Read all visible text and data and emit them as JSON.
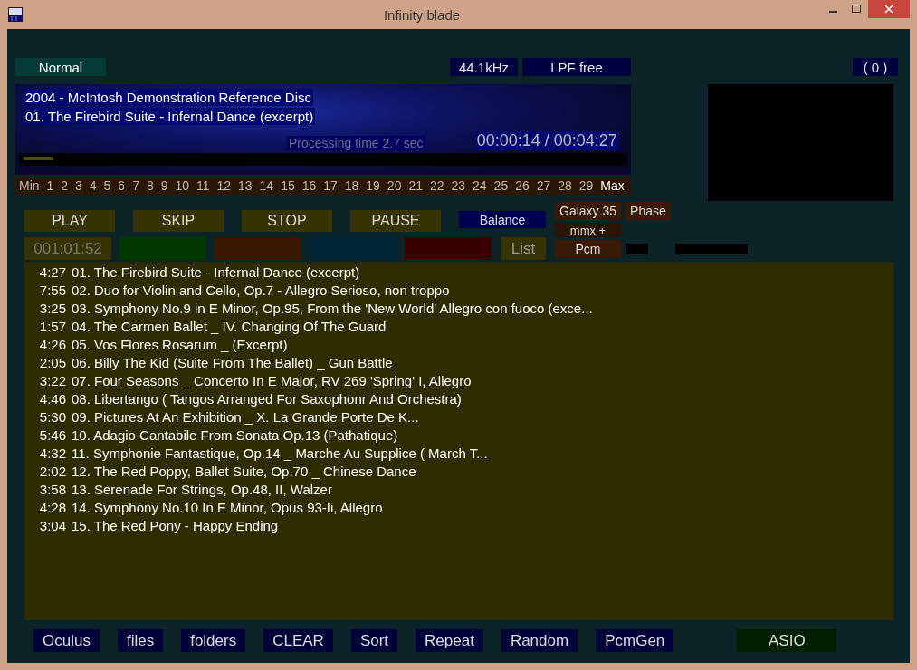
{
  "window": {
    "title": "Infinity blade"
  },
  "top_bar": {
    "mode": "Normal",
    "sample_rate": "44.1kHz",
    "filter": "LPF free",
    "counter": "( 0 )"
  },
  "now_playing": {
    "album": "2004 - McIntosh Demonstration Reference Disc",
    "track": "01. The Firebird Suite - Infernal Dance (excerpt)",
    "processing": "Processing time  2.7 sec",
    "time": "00:00:14 / 00:04:27",
    "level": 0.05
  },
  "scale": [
    {
      "label": "Min",
      "selected": false
    },
    {
      "label": "1",
      "selected": false
    },
    {
      "label": "2",
      "selected": false
    },
    {
      "label": "3",
      "selected": false
    },
    {
      "label": "4",
      "selected": false
    },
    {
      "label": "5",
      "selected": false
    },
    {
      "label": "6",
      "selected": false
    },
    {
      "label": "7",
      "selected": false
    },
    {
      "label": "8",
      "selected": false
    },
    {
      "label": "9",
      "selected": false
    },
    {
      "label": "10",
      "selected": false
    },
    {
      "label": "11",
      "selected": false
    },
    {
      "label": "12",
      "selected": false
    },
    {
      "label": "13",
      "selected": false
    },
    {
      "label": "14",
      "selected": false
    },
    {
      "label": "15",
      "selected": false
    },
    {
      "label": "16",
      "selected": false
    },
    {
      "label": "17",
      "selected": false
    },
    {
      "label": "18",
      "selected": false
    },
    {
      "label": "19",
      "selected": false
    },
    {
      "label": "20",
      "selected": false
    },
    {
      "label": "21",
      "selected": false
    },
    {
      "label": "22",
      "selected": false
    },
    {
      "label": "23",
      "selected": false
    },
    {
      "label": "24",
      "selected": false
    },
    {
      "label": "25",
      "selected": false
    },
    {
      "label": "26",
      "selected": false
    },
    {
      "label": "27",
      "selected": false
    },
    {
      "label": "28",
      "selected": false
    },
    {
      "label": "29",
      "selected": false
    },
    {
      "label": "Max",
      "selected": true
    }
  ],
  "transport": [
    "PLAY",
    "SKIP",
    "STOP",
    "PAUSE"
  ],
  "balance": "Balance",
  "effects": {
    "galaxy": "Galaxy 35",
    "phase": "Phase",
    "mmx": "mmx +",
    "pcm": "Pcm"
  },
  "elapsed": "001:01:52",
  "swatches": [
    {
      "color": "#003800"
    },
    {
      "color": "#381800"
    },
    {
      "color": "#002638"
    },
    {
      "color": "#380000"
    }
  ],
  "list_button": "List",
  "playlist": [
    {
      "time": "4:27",
      "title": "01. The Firebird Suite - Infernal Dance (excerpt)"
    },
    {
      "time": "7:55",
      "title": "02. Duo for Violin and Cello, Op.7 - Allegro Serioso, non troppo"
    },
    {
      "time": "3:25",
      "title": "03. Symphony No.9 in E Minor, Op.95, From the 'New World' Allegro con fuoco (exce..."
    },
    {
      "time": "1:57",
      "title": "04. The Carmen Ballet _ IV. Changing Of The Guard"
    },
    {
      "time": "4:26",
      "title": "05. Vos Flores Rosarum _ (Excerpt)"
    },
    {
      "time": "2:05",
      "title": "06. Billy The Kid (Suite From The Ballet) _ Gun Battle"
    },
    {
      "time": "3:22",
      "title": "07. Four Seasons _ Concerto In E Major, RV 269 'Spring' I, Allegro"
    },
    {
      "time": "4:46",
      "title": "08. Libertango ( Tangos Arranged For Saxophonr And Orchestra)"
    },
    {
      "time": "5:30",
      "title": "09. Pictures At An Exhibition _ X. La Grande Porte De K..."
    },
    {
      "time": "5:46",
      "title": "10. Adagio Cantabile From Sonata Op.13 (Pathatique)"
    },
    {
      "time": "4:32",
      "title": "11. Symphonie Fantastique, Op.14 _ Marche Au Supplice ( March T..."
    },
    {
      "time": "2:02",
      "title": "12. The Red Poppy, Ballet Suite, Op.70 _ Chinese Dance"
    },
    {
      "time": "3:58",
      "title": "13. Serenade For Strings, Op.48, II, Walzer"
    },
    {
      "time": "4:28",
      "title": "14. Symphony No.10 In E Minor, Opus 93-Ii, Allegro"
    },
    {
      "time": "3:04",
      "title": "15. The Red Pony - Happy Ending"
    }
  ],
  "bottom_buttons": [
    {
      "label": "Oculus",
      "kind": "normal"
    },
    {
      "label": "files",
      "kind": "normal"
    },
    {
      "label": "folders",
      "kind": "normal"
    },
    {
      "label": "CLEAR",
      "kind": "normal"
    },
    {
      "label": "Sort",
      "kind": "normal"
    },
    {
      "label": "Repeat",
      "kind": "normal"
    },
    {
      "label": "Random",
      "kind": "normal"
    },
    {
      "label": "PcmGen",
      "kind": "normal"
    },
    {
      "label": "ASIO",
      "kind": "output"
    }
  ]
}
